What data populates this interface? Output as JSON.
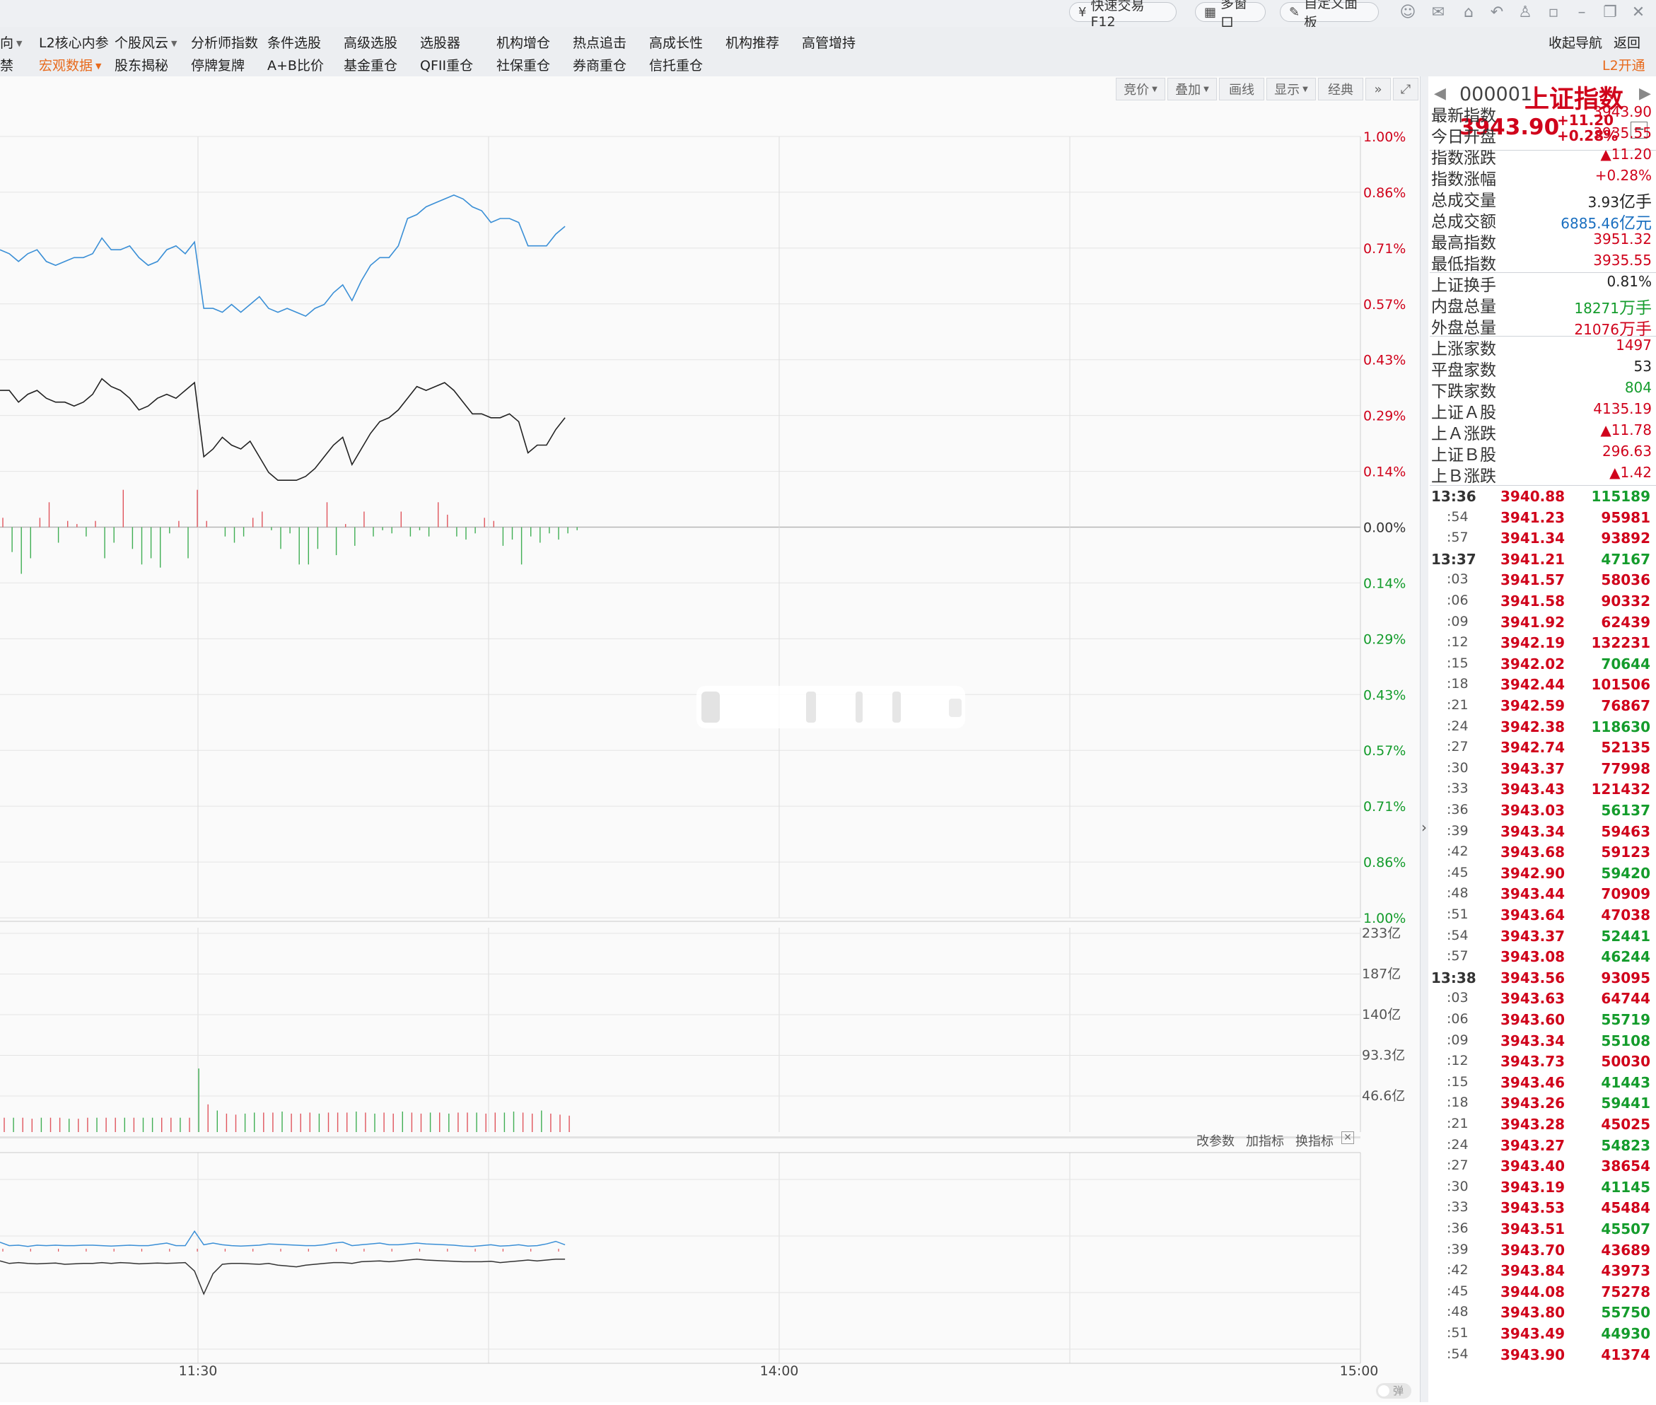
{
  "topbar": {
    "quick_trade": "快速交易F12",
    "multi_window": "多窗口",
    "custom_panel": "自定义面板"
  },
  "menu": {
    "row1": [
      "向",
      "L2核心内参",
      "个股风云",
      "分析师指数",
      "条件选股",
      "高级选股",
      "选股器",
      "机构增仓",
      "热点追击",
      "高成长性",
      "机构推荐",
      "高管增持"
    ],
    "row2": [
      "禁",
      "宏观数据",
      "股东揭秘",
      "停牌复牌",
      "A+B比价",
      "基金重仓",
      "QFII重仓",
      "社保重仓",
      "券商重仓",
      "信托重仓"
    ],
    "collapse_nav": "收起导航",
    "back": "返回",
    "l2_open": "L2开通"
  },
  "chart_toolbar": {
    "bid": "竞价",
    "overlay": "叠加",
    "draw": "画线",
    "display": "显示",
    "classic": "经典"
  },
  "indicator_toolbar": {
    "edit_params": "改参数",
    "add_indicator": "加指标",
    "switch_indicator": "换指标"
  },
  "popup_label": "弹",
  "chart_data": {
    "type": "line",
    "y_right_labels_up": [
      "1.00%",
      "0.86%",
      "0.71%",
      "0.57%",
      "0.43%",
      "0.29%",
      "0.14%",
      "0.00%"
    ],
    "y_right_labels_down": [
      "0.14%",
      "0.29%",
      "0.43%",
      "0.57%",
      "0.71%",
      "0.86%",
      "1.00%"
    ],
    "ylim_pct": [
      -1.0,
      1.0
    ],
    "x_tick_labels": [
      "11:30",
      "14:00",
      "15:00"
    ],
    "series": [
      {
        "color": "#3a8fd6",
        "values": [
          0.71,
          0.7,
          0.68,
          0.7,
          0.71,
          0.68,
          0.67,
          0.68,
          0.69,
          0.69,
          0.7,
          0.74,
          0.71,
          0.71,
          0.72,
          0.69,
          0.67,
          0.68,
          0.71,
          0.72,
          0.7,
          0.73,
          0.56,
          0.56,
          0.55,
          0.57,
          0.55,
          0.57,
          0.59,
          0.56,
          0.55,
          0.56,
          0.55,
          0.54,
          0.56,
          0.57,
          0.6,
          0.62,
          0.58,
          0.63,
          0.67,
          0.69,
          0.69,
          0.72,
          0.79,
          0.8,
          0.82,
          0.83,
          0.84,
          0.85,
          0.84,
          0.82,
          0.81,
          0.78,
          0.79,
          0.79,
          0.78,
          0.72,
          0.72,
          0.72,
          0.75,
          0.77
        ]
      },
      {
        "color": "#222222",
        "values": [
          0.35,
          0.35,
          0.32,
          0.34,
          0.35,
          0.33,
          0.32,
          0.32,
          0.31,
          0.32,
          0.34,
          0.38,
          0.36,
          0.35,
          0.33,
          0.3,
          0.31,
          0.33,
          0.34,
          0.33,
          0.35,
          0.37,
          0.18,
          0.2,
          0.23,
          0.21,
          0.2,
          0.22,
          0.18,
          0.14,
          0.12,
          0.12,
          0.12,
          0.13,
          0.15,
          0.18,
          0.21,
          0.23,
          0.16,
          0.2,
          0.24,
          0.27,
          0.28,
          0.3,
          0.33,
          0.36,
          0.35,
          0.36,
          0.37,
          0.35,
          0.32,
          0.29,
          0.29,
          0.28,
          0.28,
          0.29,
          0.27,
          0.19,
          0.21,
          0.21,
          0.25,
          0.28
        ]
      }
    ],
    "pane1_bars": [
      3,
      -8,
      -15,
      -10,
      3,
      8,
      -5,
      2,
      1,
      -3,
      2,
      -10,
      -5,
      12,
      -7,
      -12,
      -10,
      -13,
      -2,
      2,
      -10,
      12,
      2,
      0,
      -3,
      -5,
      -3,
      3,
      5,
      -1,
      -7,
      -2,
      -12,
      -12,
      -7,
      8,
      -9,
      1,
      -6,
      5,
      -3,
      -1,
      -2,
      5,
      -3,
      -1,
      -3,
      8,
      4,
      -3,
      -4,
      -2,
      3,
      2,
      -6,
      -4,
      -12,
      -3,
      -5,
      -2,
      -4,
      -2,
      -1
    ]
  },
  "volume_axis_labels": [
    "233亿",
    "187亿",
    "140亿",
    "93.3亿",
    "46.6亿"
  ],
  "volume_data": [
    14,
    14,
    14,
    13,
    14,
    14,
    14,
    13,
    13,
    14,
    14,
    14,
    14,
    14,
    14,
    14,
    14,
    14,
    14,
    14,
    14,
    62,
    27,
    21,
    18,
    17,
    18,
    19,
    19,
    19,
    20,
    18,
    18,
    19,
    18,
    19,
    19,
    19,
    20,
    19,
    18,
    19,
    18,
    20,
    19,
    18,
    19,
    19,
    18,
    19,
    19,
    19,
    18,
    19,
    19,
    20,
    19,
    18,
    21,
    18,
    17,
    16
  ],
  "volume_colors": [
    "r",
    "g",
    "r",
    "r",
    "g",
    "r",
    "r",
    "g",
    "r",
    "r",
    "g",
    "r",
    "r",
    "g",
    "r",
    "g",
    "g",
    "r",
    "r",
    "g",
    "r",
    "g",
    "r",
    "g",
    "r",
    "r",
    "g",
    "g",
    "r",
    "r",
    "g",
    "r",
    "r",
    "r",
    "g",
    "r",
    "r",
    "r",
    "g",
    "r",
    "g",
    "r",
    "r",
    "g",
    "r",
    "r",
    "g",
    "r",
    "g",
    "r",
    "r",
    "g",
    "r",
    "r",
    "g",
    "g",
    "r",
    "r",
    "g",
    "r",
    "r",
    "r"
  ],
  "indicator_pane": {
    "blue": [
      1.1,
      0.7,
      0.75,
      0.6,
      0.75,
      0.7,
      0.75,
      0.7,
      0.7,
      0.75,
      0.75,
      0.7,
      0.65,
      0.7,
      0.75,
      0.7,
      0.7,
      0.85,
      1.0,
      0.7,
      0.7,
      2.4,
      0.8,
      1.0,
      0.8,
      0.7,
      0.65,
      0.7,
      0.75,
      0.9,
      0.85,
      0.8,
      0.75,
      0.7,
      0.7,
      0.8,
      1.0,
      1.1,
      0.7,
      0.8,
      0.9,
      1.0,
      0.8,
      0.8,
      0.9,
      1.0,
      0.9,
      0.85,
      0.8,
      0.75,
      0.65,
      0.6,
      0.7,
      0.8,
      0.65,
      0.7,
      0.8,
      0.65,
      0.7,
      0.9,
      1.2,
      0.8
    ],
    "black": [
      -1.1,
      -1.4,
      -1.3,
      -1.4,
      -1.45,
      -1.4,
      -1.35,
      -1.5,
      -1.45,
      -1.4,
      -1.4,
      -1.3,
      -1.4,
      -1.3,
      -1.35,
      -1.45,
      -1.4,
      -1.35,
      -1.4,
      -1.35,
      -1.3,
      -2.3,
      -5.0,
      -2.6,
      -1.5,
      -1.4,
      -1.4,
      -1.45,
      -1.5,
      -1.4,
      -1.6,
      -1.7,
      -1.8,
      -1.6,
      -1.5,
      -1.4,
      -1.3,
      -1.3,
      -1.4,
      -1.2,
      -1.15,
      -1.1,
      -1.2,
      -1.1,
      -1.0,
      -0.9,
      -1.0,
      -1.05,
      -1.1,
      -1.15,
      -1.2,
      -1.2,
      -1.2,
      -1.15,
      -1.3,
      -1.2,
      -1.1,
      -1.0,
      -1.1,
      -1.0,
      -0.9,
      -0.9
    ]
  },
  "panel": {
    "code": "000001",
    "name": "上证指数",
    "price": "3943.90",
    "change": "+11.20",
    "change_pct": "+0.28%",
    "stats1": [
      {
        "label": "最新指数",
        "value": "3943.90",
        "cls": "red"
      },
      {
        "label": "今日开盘",
        "value": "3935.55",
        "cls": "red"
      },
      {
        "label": "指数涨跌",
        "value": "▲11.20",
        "cls": "red"
      },
      {
        "label": "指数涨幅",
        "value": "+0.28%",
        "cls": "red"
      },
      {
        "label": "总成交量",
        "value": "3.93",
        "unit": "亿手",
        "cls": "dark"
      },
      {
        "label": "总成交额",
        "value": "6885.46",
        "unit": "亿元",
        "cls": "blue"
      },
      {
        "label": "最高指数",
        "value": "3951.32",
        "cls": "red"
      },
      {
        "label": "最低指数",
        "value": "3935.55",
        "cls": "red"
      }
    ],
    "stats2": [
      {
        "label": "上证换手",
        "value": "0.81%",
        "cls": "dark"
      },
      {
        "label": "内盘总量",
        "value": "18271",
        "unit": "万手",
        "cls": "green"
      },
      {
        "label": "外盘总量",
        "value": "21076",
        "unit": "万手",
        "cls": "red"
      }
    ],
    "stats3": [
      {
        "label": "上涨家数",
        "value": "1497",
        "cls": "red"
      },
      {
        "label": "平盘家数",
        "value": "53",
        "cls": "dark"
      },
      {
        "label": "下跌家数",
        "value": "804",
        "cls": "green"
      },
      {
        "label": "上证Ａ股",
        "value": "4135.19",
        "cls": "red"
      },
      {
        "label": "上Ａ涨跌",
        "value": "▲11.78",
        "cls": "red"
      },
      {
        "label": "上证Ｂ股",
        "value": "296.63",
        "cls": "red"
      },
      {
        "label": "上Ｂ涨跌",
        "value": "▲1.42",
        "cls": "red"
      }
    ],
    "ticks": [
      {
        "t": "13:36",
        "p": "3940.88",
        "v": "115189",
        "c": "green"
      },
      {
        "t": ":54",
        "p": "3941.23",
        "v": "95981",
        "c": "red"
      },
      {
        "t": ":57",
        "p": "3941.34",
        "v": "93892",
        "c": "red"
      },
      {
        "t": "13:37",
        "p": "3941.21",
        "v": "47167",
        "c": "green"
      },
      {
        "t": ":03",
        "p": "3941.57",
        "v": "58036",
        "c": "red"
      },
      {
        "t": ":06",
        "p": "3941.58",
        "v": "90332",
        "c": "red"
      },
      {
        "t": ":09",
        "p": "3941.92",
        "v": "62439",
        "c": "red"
      },
      {
        "t": ":12",
        "p": "3942.19",
        "v": "132231",
        "c": "red"
      },
      {
        "t": ":15",
        "p": "3942.02",
        "v": "70644",
        "c": "green"
      },
      {
        "t": ":18",
        "p": "3942.44",
        "v": "101506",
        "c": "red"
      },
      {
        "t": ":21",
        "p": "3942.59",
        "v": "76867",
        "c": "red"
      },
      {
        "t": ":24",
        "p": "3942.38",
        "v": "118630",
        "c": "green"
      },
      {
        "t": ":27",
        "p": "3942.74",
        "v": "52135",
        "c": "red"
      },
      {
        "t": ":30",
        "p": "3943.37",
        "v": "77998",
        "c": "red"
      },
      {
        "t": ":33",
        "p": "3943.43",
        "v": "121432",
        "c": "red"
      },
      {
        "t": ":36",
        "p": "3943.03",
        "v": "56137",
        "c": "green"
      },
      {
        "t": ":39",
        "p": "3943.34",
        "v": "59463",
        "c": "red"
      },
      {
        "t": ":42",
        "p": "3943.68",
        "v": "59123",
        "c": "red"
      },
      {
        "t": ":45",
        "p": "3942.90",
        "v": "59420",
        "c": "green"
      },
      {
        "t": ":48",
        "p": "3943.44",
        "v": "70909",
        "c": "red"
      },
      {
        "t": ":51",
        "p": "3943.64",
        "v": "47038",
        "c": "red"
      },
      {
        "t": ":54",
        "p": "3943.37",
        "v": "52441",
        "c": "green"
      },
      {
        "t": ":57",
        "p": "3943.08",
        "v": "46244",
        "c": "green"
      },
      {
        "t": "13:38",
        "p": "3943.56",
        "v": "93095",
        "c": "red"
      },
      {
        "t": ":03",
        "p": "3943.63",
        "v": "64744",
        "c": "red"
      },
      {
        "t": ":06",
        "p": "3943.60",
        "v": "55719",
        "c": "green"
      },
      {
        "t": ":09",
        "p": "3943.34",
        "v": "55108",
        "c": "green"
      },
      {
        "t": ":12",
        "p": "3943.73",
        "v": "50030",
        "c": "red"
      },
      {
        "t": ":15",
        "p": "3943.46",
        "v": "41443",
        "c": "green"
      },
      {
        "t": ":18",
        "p": "3943.26",
        "v": "59441",
        "c": "green"
      },
      {
        "t": ":21",
        "p": "3943.28",
        "v": "45025",
        "c": "red"
      },
      {
        "t": ":24",
        "p": "3943.27",
        "v": "54823",
        "c": "green"
      },
      {
        "t": ":27",
        "p": "3943.40",
        "v": "38654",
        "c": "red"
      },
      {
        "t": ":30",
        "p": "3943.19",
        "v": "41145",
        "c": "green"
      },
      {
        "t": ":33",
        "p": "3943.53",
        "v": "45484",
        "c": "red"
      },
      {
        "t": ":36",
        "p": "3943.51",
        "v": "45507",
        "c": "green"
      },
      {
        "t": ":39",
        "p": "3943.70",
        "v": "43689",
        "c": "red"
      },
      {
        "t": ":42",
        "p": "3943.84",
        "v": "43973",
        "c": "red"
      },
      {
        "t": ":45",
        "p": "3944.08",
        "v": "75278",
        "c": "red"
      },
      {
        "t": ":48",
        "p": "3943.80",
        "v": "55750",
        "c": "green"
      },
      {
        "t": ":51",
        "p": "3943.49",
        "v": "44930",
        "c": "green"
      },
      {
        "t": ":54",
        "p": "3943.90",
        "v": "41374",
        "c": "red"
      }
    ]
  }
}
